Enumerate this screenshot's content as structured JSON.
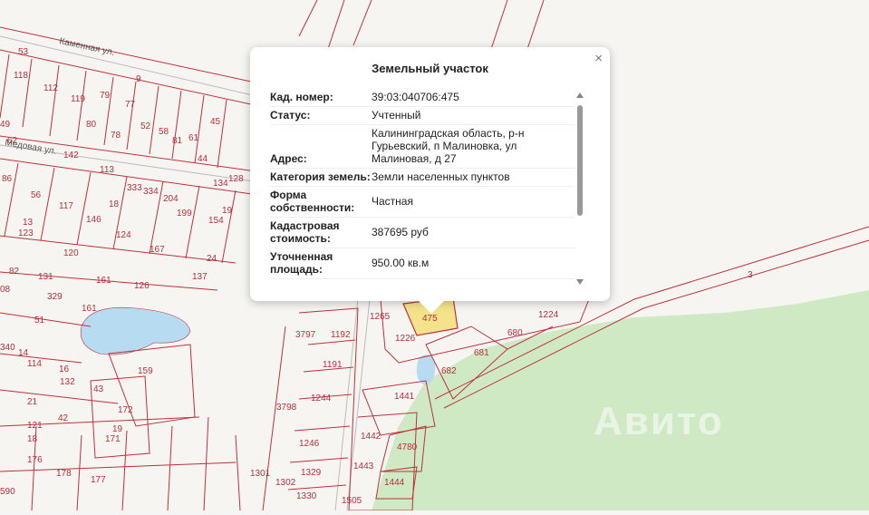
{
  "streets": [
    "Каменная ул.",
    "Медовая ул."
  ],
  "parcels": [
    "118",
    "112",
    "119",
    "79",
    "77",
    "52",
    "58",
    "81",
    "61",
    "45",
    "49",
    "62",
    "142",
    "80",
    "78",
    "113",
    "333",
    "334",
    "204",
    "199",
    "44",
    "134",
    "128",
    "86",
    "56",
    "117",
    "146",
    "18",
    "124",
    "167",
    "154",
    "19",
    "123",
    "13",
    "120",
    "82",
    "131",
    "161",
    "126",
    "137",
    "24",
    "329",
    "51",
    "08",
    "161",
    "159",
    "340",
    "14",
    "114",
    "16",
    "132",
    "43",
    "21",
    "121",
    "172",
    "42",
    "19",
    "171",
    "18",
    "176",
    "178",
    "177",
    "590",
    "3797",
    "1192",
    "1191",
    "1244",
    "3798",
    "1246",
    "1265",
    "1226",
    "475",
    "681",
    "680",
    "1224",
    "682",
    "1441",
    "1442",
    "4780",
    "1443",
    "1444",
    "1301",
    "1302",
    "1329",
    "1330",
    "1505",
    "3",
    "53",
    "9"
  ],
  "popup": {
    "title": "Земельный участок",
    "close_label": "×",
    "rows": [
      {
        "key": "Кад. номер:",
        "value": "39:03:040706:475"
      },
      {
        "key": "Статус:",
        "value": "Учтенный"
      },
      {
        "key": "Адрес:",
        "value": "Калининградская область, р-н Гурьевский, п Малиновка, ул Малиновая, д 27"
      },
      {
        "key": "Категория земель:",
        "value": "Земли населенных пунктов"
      },
      {
        "key": "Форма собственности:",
        "value": "Частная"
      },
      {
        "key": "Кадастровая стоимость:",
        "value": "387695 руб"
      },
      {
        "key": "Уточненная площадь:",
        "value": "950.00 кв.м"
      }
    ]
  },
  "watermark": "Авито",
  "colors": {
    "parcel_line": "#c0303a",
    "selected_parcel": "#f4e38a",
    "forest": "#cfe9c4",
    "water": "#b7dcf2"
  }
}
